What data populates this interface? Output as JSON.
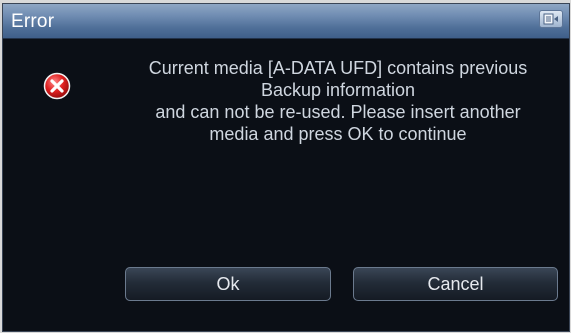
{
  "window": {
    "title": "Error"
  },
  "message": {
    "lines": [
      "Current media [A-DATA UFD] contains previous",
      "Backup information",
      "and can not be re-used. Please insert another",
      "media and press OK to continue"
    ]
  },
  "buttons": {
    "ok_label": "Ok",
    "cancel_label": "Cancel"
  },
  "icons": {
    "title_button": "window-menu-icon",
    "status": "error-icon"
  },
  "colors": {
    "error_red": "#e02020",
    "text": "#cfd6df",
    "background": "#0b0f16"
  }
}
